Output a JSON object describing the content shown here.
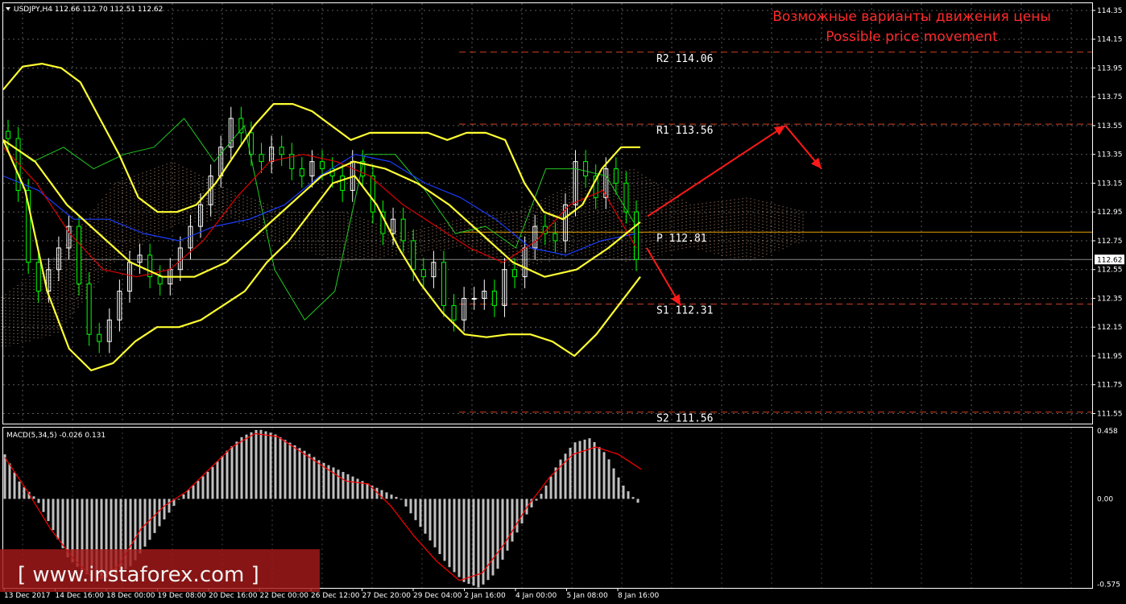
{
  "header": {
    "symbol_line": "USDJPY,H4  112.66 112.70 112.51 112.62",
    "macd_line": "MACD(5,34,5) -0.026 0.131"
  },
  "annotation": {
    "title_ru": "Возможные варианты движения цены",
    "title_en": "Possible price movement"
  },
  "watermark": "[ www.instaforex.com ]",
  "colors": {
    "background": "#000000",
    "candle_bull": "#ffffff",
    "candle_bear": "#00ff00",
    "bollinger": "#ffff33",
    "ma_red": "#dd0000",
    "ma_blue": "#1a3dff",
    "green_line": "#22cc22",
    "pivot_line": "#e8a000",
    "level_line": "#d04020",
    "arrow": "#ff1a1a",
    "macd_hist": "#c0c0c0",
    "macd_signal": "#ff0000"
  },
  "chart_data": {
    "type": "line",
    "symbol": "USDJPY",
    "timeframe": "H4",
    "ohlc_header": {
      "open": 112.66,
      "high": 112.7,
      "low": 112.51,
      "close": 112.62
    },
    "current_price": 112.62,
    "current_price_label": "112.62",
    "ylim": [
      111.48,
      114.4
    ],
    "y_ticks": [
      "114.35",
      "114.15",
      "113.95",
      "113.75",
      "113.55",
      "113.35",
      "113.15",
      "112.95",
      "112.75",
      "112.55",
      "112.35",
      "112.15",
      "111.95",
      "111.75",
      "111.55"
    ],
    "x_ticks": [
      "13 Dec 2017",
      "14 Dec 16:00",
      "18 Dec 00:00",
      "19 Dec 08:00",
      "20 Dec 16:00",
      "22 Dec 00:00",
      "26 Dec 12:00",
      "27 Dec 20:00",
      "29 Dec 04:00",
      "2 Jan 16:00",
      "4 Jan 00:00",
      "5 Jan 08:00",
      "8 Jan 16:00"
    ],
    "pivot_levels": [
      {
        "name": "R2",
        "value": 114.06,
        "label": "R2  114.06"
      },
      {
        "name": "R1",
        "value": 113.56,
        "label": "R1  113.56"
      },
      {
        "name": "P",
        "value": 112.81,
        "label": "P  112.81"
      },
      {
        "name": "S1",
        "value": 112.31,
        "label": "S1  112.31"
      },
      {
        "name": "S2",
        "value": 111.56,
        "label": "S2  111.56"
      }
    ],
    "close": [
      113.46,
      113.1,
      112.6,
      112.4,
      112.55,
      112.7,
      112.85,
      112.45,
      112.1,
      112.05,
      112.2,
      112.4,
      112.6,
      112.65,
      112.5,
      112.45,
      112.55,
      112.7,
      112.85,
      113.0,
      113.2,
      113.4,
      113.6,
      113.5,
      113.35,
      113.3,
      113.4,
      113.35,
      113.25,
      113.2,
      113.3,
      113.25,
      113.2,
      113.1,
      113.3,
      113.2,
      112.95,
      112.8,
      112.9,
      112.75,
      112.55,
      112.5,
      112.6,
      112.3,
      112.2,
      112.35,
      112.35,
      112.4,
      112.3,
      112.55,
      112.5,
      112.7,
      112.85,
      112.8,
      112.75,
      113.0,
      113.3,
      113.2,
      113.05,
      113.25,
      113.15,
      112.95,
      112.62
    ],
    "bb_upper": [
      113.8,
      113.96,
      113.98,
      113.95,
      113.85,
      113.6,
      113.35,
      113.05,
      112.95,
      112.95,
      113.0,
      113.15,
      113.35,
      113.55,
      113.7,
      113.7,
      113.65,
      113.55,
      113.45,
      113.5,
      113.5,
      113.5,
      113.5,
      113.45,
      113.5,
      113.5,
      113.45,
      113.15,
      112.95,
      112.9,
      113.0,
      113.25,
      113.4,
      113.4
    ],
    "bb_lower": [
      113.45,
      113.1,
      112.4,
      112.0,
      111.85,
      111.9,
      112.05,
      112.15,
      112.15,
      112.2,
      112.3,
      112.4,
      112.6,
      112.75,
      112.95,
      113.15,
      113.2,
      113.0,
      112.7,
      112.45,
      112.25,
      112.1,
      112.08,
      112.1,
      112.1,
      112.05,
      111.95,
      112.1,
      112.3,
      112.5
    ],
    "bb_middle": [
      113.45,
      113.3,
      113.0,
      112.8,
      112.6,
      112.5,
      112.5,
      112.6,
      112.8,
      113.0,
      113.2,
      113.3,
      113.25,
      113.15,
      113.0,
      112.8,
      112.6,
      112.5,
      112.55,
      112.7,
      112.88
    ],
    "ma_red": [
      113.4,
      113.15,
      112.8,
      112.55,
      112.5,
      112.55,
      112.75,
      113.05,
      113.3,
      113.35,
      113.3,
      113.2,
      113.0,
      112.85,
      112.7,
      112.6,
      112.75,
      113.0,
      113.1,
      112.7
    ],
    "ma_blue": [
      113.2,
      113.1,
      112.9,
      112.9,
      112.8,
      112.75,
      112.85,
      112.9,
      113.0,
      113.2,
      113.35,
      113.3,
      113.15,
      113.05,
      112.9,
      112.7,
      112.65,
      112.75,
      112.8
    ],
    "green_line": [
      113.45,
      113.3,
      113.4,
      113.25,
      113.35,
      113.4,
      113.6,
      113.3,
      113.55,
      112.55,
      112.2,
      112.4,
      113.35,
      113.35,
      113.1,
      112.8,
      112.85,
      112.7,
      113.25,
      113.25,
      113.2,
      112.85
    ],
    "cloud_upper": [
      112.35,
      112.65,
      113.15,
      113.3,
      113.1,
      112.95,
      112.95,
      112.8,
      112.9,
      112.95,
      113.15,
      113.25,
      113.0,
      113.05,
      112.95
    ],
    "cloud_lower": [
      112.0,
      112.1,
      112.6,
      112.85,
      112.9,
      112.7,
      112.6,
      112.65,
      112.7,
      112.55,
      112.65,
      112.6,
      112.7,
      112.6,
      112.75
    ],
    "projected_paths": [
      {
        "name": "bullish",
        "points": [
          112.92,
          113.55,
          113.25
        ]
      },
      {
        "name": "bearish",
        "points": [
          112.7,
          112.3
        ]
      }
    ],
    "macd": {
      "label": "MACD(5,34,5)",
      "value": -0.026,
      "signal_value": 0.131,
      "ylim": [
        -0.6,
        0.48
      ],
      "y_ticks": [
        "0.458",
        "0.00",
        "-0.575"
      ],
      "histogram": [
        0.3,
        0.1,
        0.0,
        -0.2,
        -0.4,
        -0.5,
        -0.54,
        -0.52,
        -0.45,
        -0.3,
        -0.15,
        0.0,
        0.1,
        0.2,
        0.32,
        0.42,
        0.47,
        0.44,
        0.38,
        0.32,
        0.25,
        0.2,
        0.15,
        0.1,
        0.05,
        0.0,
        -0.15,
        -0.3,
        -0.45,
        -0.56,
        -0.6,
        -0.5,
        -0.3,
        -0.1,
        0.05,
        0.25,
        0.38,
        0.41,
        0.3,
        0.1,
        -0.026
      ],
      "signal": [
        0.28,
        0.05,
        -0.2,
        -0.4,
        -0.55,
        -0.45,
        -0.2,
        -0.05,
        0.05,
        0.2,
        0.35,
        0.44,
        0.42,
        0.32,
        0.22,
        0.12,
        0.1,
        -0.05,
        -0.25,
        -0.42,
        -0.55,
        -0.5,
        -0.3,
        -0.05,
        0.15,
        0.3,
        0.35,
        0.3,
        0.2
      ]
    }
  }
}
